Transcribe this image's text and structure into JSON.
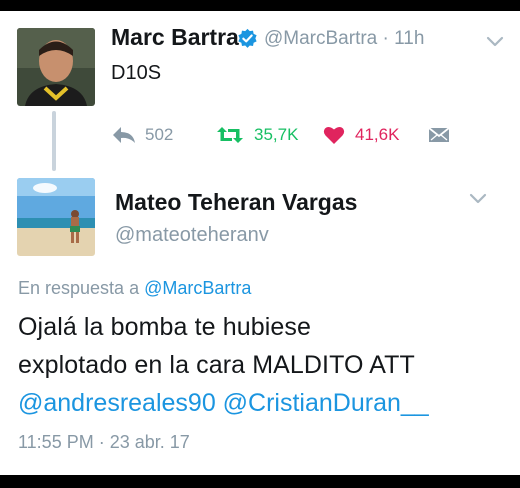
{
  "tweet": {
    "author_name": "Marc Bartra",
    "author_handle": "@MarcBartra",
    "separator": "·",
    "time_ago": "11h",
    "text": "D10S",
    "actions": {
      "reply_count": "502",
      "retweet_count": "35,7K",
      "like_count": "41,6K"
    },
    "colors": {
      "retweet": "#17bf63",
      "like": "#e0245e",
      "icon_gray": "#8899a6"
    }
  },
  "reply": {
    "author_name": "Mateo Teheran Vargas",
    "author_handle": "@mateoteheranv",
    "in_reply_to_label": "En respuesta a",
    "in_reply_to_handle": "@MarcBartra",
    "text_line1": "Ojalá la bomba te hubiese",
    "text_line2": "explotado en la cara MALDITO ATT",
    "mention1": "@andresreales90",
    "mention2": "@CristianDuran__",
    "timestamp": "11:55 PM · 23 abr. 17"
  },
  "colors": {
    "link": "#1b95e0",
    "text": "#14171a",
    "muted": "#8899a6"
  }
}
